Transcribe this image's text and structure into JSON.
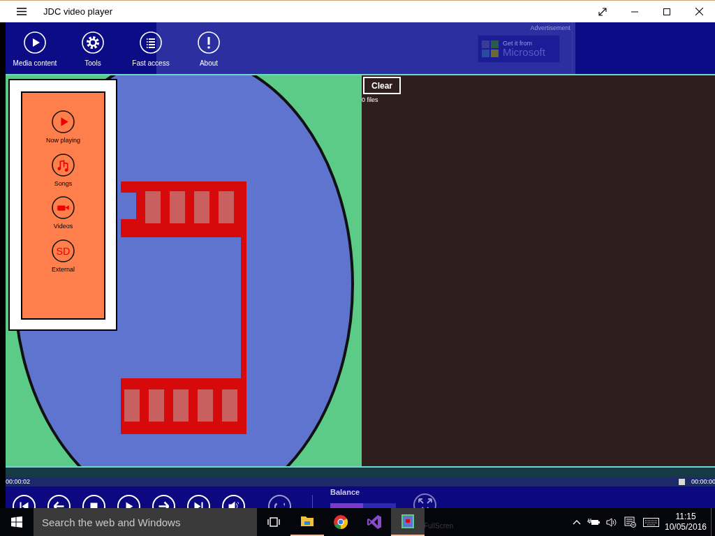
{
  "window": {
    "title": "JDC video player"
  },
  "toolbar": {
    "items": [
      {
        "label": "Media content",
        "kind": "play"
      },
      {
        "label": "Tools",
        "kind": "gear"
      },
      {
        "label": "Fast access",
        "kind": "list"
      },
      {
        "label": "About",
        "kind": "info"
      }
    ],
    "ad_label": "Advertisement",
    "ad_badge_top": "Get it from",
    "ad_badge_name": "Microsoft"
  },
  "menu": {
    "items": [
      {
        "label": "Now playing",
        "kind": "play"
      },
      {
        "label": "Songs",
        "kind": "music"
      },
      {
        "label": "Videos",
        "kind": "camera"
      },
      {
        "label": "External",
        "kind": "sd",
        "icon_text": "SD"
      }
    ]
  },
  "files": {
    "clear_button": "Clear",
    "count": "0 files"
  },
  "progress": {
    "elapsed": "00:00:02",
    "remaining": "00:00:00",
    "level": 0.99
  },
  "controls": {
    "buttons": [
      {
        "kind": "prev"
      },
      {
        "kind": "back"
      },
      {
        "kind": "stop"
      },
      {
        "kind": "play"
      },
      {
        "kind": "forward"
      },
      {
        "kind": "next"
      },
      {
        "kind": "volume"
      },
      {
        "kind": "repeat"
      }
    ],
    "balance_label": "Balance",
    "balance": {
      "level": 0.5
    },
    "fullscreen_label": "FullScren"
  },
  "taskbar": {
    "search_placeholder": "Search the web and Windows",
    "apps": [
      {
        "kind": "taskview",
        "running": false,
        "selected": false
      },
      {
        "kind": "explorer",
        "running": true,
        "selected": false
      },
      {
        "kind": "chrome",
        "running": false,
        "selected": false
      },
      {
        "kind": "vs",
        "running": false,
        "selected": false
      },
      {
        "kind": "app",
        "running": true,
        "selected": true
      }
    ],
    "time": "11:15",
    "date": "10/05/2016"
  }
}
